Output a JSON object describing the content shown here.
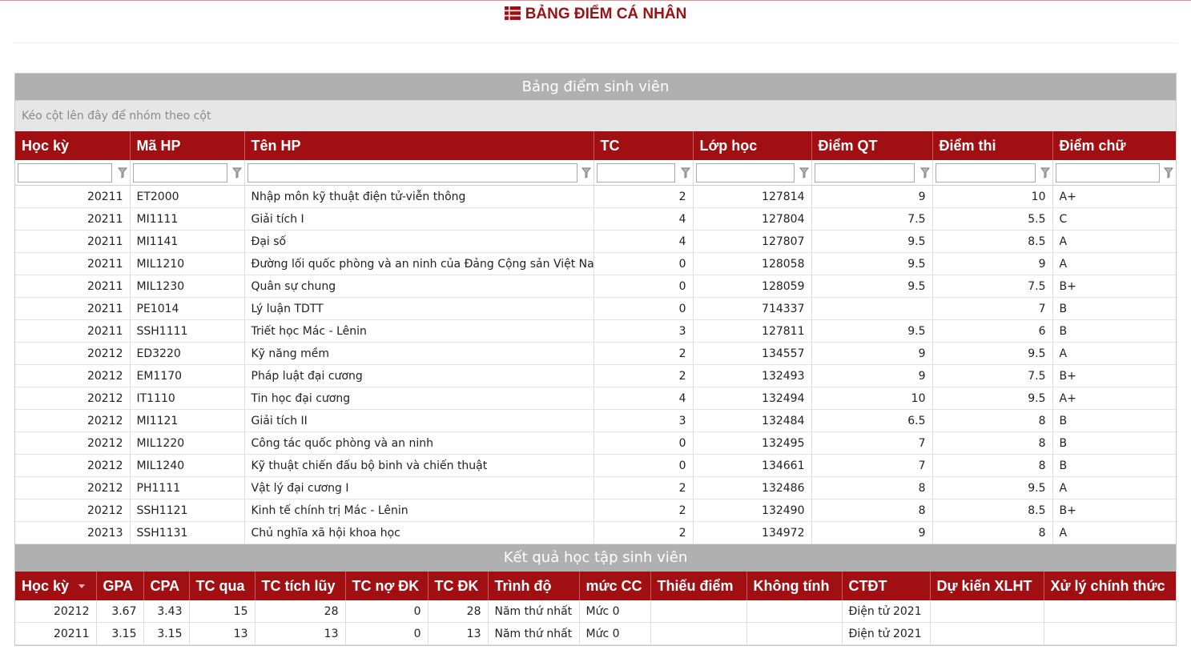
{
  "page": {
    "title": "BẢNG ĐIỂM CÁ NHÂN"
  },
  "grades": {
    "caption": "Bảng điểm sinh viên",
    "group_hint": "Kéo cột lên đây để nhóm theo cột",
    "columns": [
      "Học kỳ",
      "Mã HP",
      "Tên HP",
      "TC",
      "Lớp học",
      "Điểm QT",
      "Điểm thi",
      "Điểm chữ"
    ],
    "rows": [
      [
        "20211",
        "ET2000",
        "Nhập môn kỹ thuật điện tử-viễn thông",
        "2",
        "127814",
        "9",
        "10",
        "A+"
      ],
      [
        "20211",
        "MI1111",
        "Giải tích I",
        "4",
        "127804",
        "7.5",
        "5.5",
        "C"
      ],
      [
        "20211",
        "MI1141",
        "Đại số",
        "4",
        "127807",
        "9.5",
        "8.5",
        "A"
      ],
      [
        "20211",
        "MIL1210",
        "Đường lối quốc phòng và an ninh của Đảng Cộng sản Việt Nam",
        "0",
        "128058",
        "9.5",
        "9",
        "A"
      ],
      [
        "20211",
        "MIL1230",
        "Quân sự chung",
        "0",
        "128059",
        "9.5",
        "7.5",
        "B+"
      ],
      [
        "20211",
        "PE1014",
        "Lý luận TDTT",
        "0",
        "714337",
        "",
        "7",
        "B"
      ],
      [
        "20211",
        "SSH1111",
        "Triết học Mác - Lênin",
        "3",
        "127811",
        "9.5",
        "6",
        "B"
      ],
      [
        "20212",
        "ED3220",
        "Kỹ năng mềm",
        "2",
        "134557",
        "9",
        "9.5",
        "A"
      ],
      [
        "20212",
        "EM1170",
        "Pháp luật đại cương",
        "2",
        "132493",
        "9",
        "7.5",
        "B+"
      ],
      [
        "20212",
        "IT1110",
        "Tin học đại cương",
        "4",
        "132494",
        "10",
        "9.5",
        "A+"
      ],
      [
        "20212",
        "MI1121",
        "Giải tích II",
        "3",
        "132484",
        "6.5",
        "8",
        "B"
      ],
      [
        "20212",
        "MIL1220",
        "Công tác quốc phòng và an ninh",
        "0",
        "132495",
        "7",
        "8",
        "B"
      ],
      [
        "20212",
        "MIL1240",
        "Kỹ thuật chiến đấu bộ binh và chiến thuật",
        "0",
        "134661",
        "7",
        "8",
        "B"
      ],
      [
        "20212",
        "PH1111",
        "Vật lý đại cương I",
        "2",
        "132486",
        "8",
        "9.5",
        "A"
      ],
      [
        "20212",
        "SSH1121",
        "Kinh tế chính trị Mác - Lênin",
        "2",
        "132490",
        "8",
        "8.5",
        "B+"
      ],
      [
        "20213",
        "SSH1131",
        "Chủ nghĩa xã hội khoa học",
        "2",
        "134972",
        "9",
        "8",
        "A"
      ]
    ]
  },
  "results": {
    "caption": "Kết quả học tập sinh viên",
    "columns": [
      "Học kỳ",
      "GPA",
      "CPA",
      "TC qua",
      "TC tích lũy",
      "TC nợ ĐK",
      "TC ĐK",
      "Trình độ",
      "mức CC",
      "Thiếu điểm",
      "Không tính",
      "CTĐT",
      "Dự kiến XLHT",
      "Xử lý chính thức"
    ],
    "rows": [
      [
        "20212",
        "3.67",
        "3.43",
        "15",
        "28",
        "0",
        "28",
        "Năm thứ nhất",
        "Mức 0",
        "",
        "",
        "Điện tử 2021",
        "",
        ""
      ],
      [
        "20211",
        "3.15",
        "3.15",
        "13",
        "13",
        "0",
        "13",
        "Năm thứ nhất",
        "Mức 0",
        "",
        "",
        "Điện tử 2021",
        "",
        ""
      ]
    ]
  },
  "colors": {
    "header_red": "#a10f12",
    "caption_gray": "#b0b0b0",
    "title_red": "#9b1114"
  }
}
